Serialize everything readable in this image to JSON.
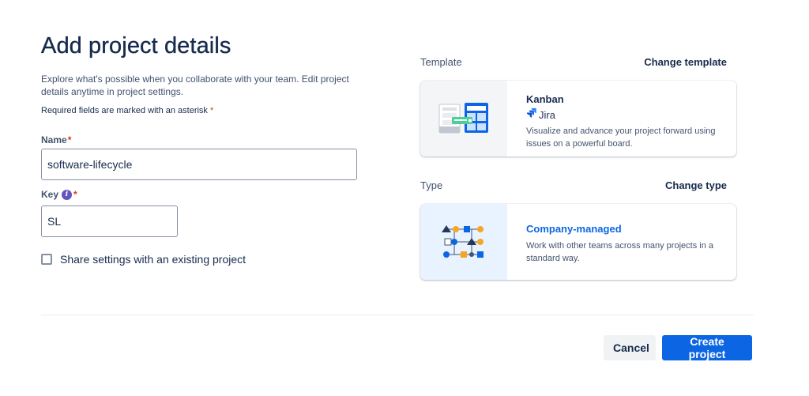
{
  "page": {
    "title": "Add project details",
    "intro": "Explore what's possible when you collaborate with your team. Edit project details anytime in project settings.",
    "required_note": "Required fields are marked with an asterisk",
    "asterisk": "*"
  },
  "form": {
    "name_label": "Name",
    "name_value": "software-lifecycle",
    "key_label": "Key",
    "key_value": "SL",
    "share_checkbox_label": "Share settings with an existing project",
    "share_checked": false
  },
  "template": {
    "section_label": "Template",
    "change_link": "Change template",
    "name": "Kanban",
    "product": "Jira",
    "description": "Visualize and advance your project forward using issues on a powerful board."
  },
  "type": {
    "section_label": "Type",
    "change_link": "Change type",
    "name": "Company-managed",
    "description": "Work with other teams across many projects in a standard way."
  },
  "actions": {
    "cancel_label": "Cancel",
    "create_label": "Create project"
  },
  "icons": {
    "info": "info-icon",
    "jira_logo": "jira-logo-icon",
    "kanban_illustration": "kanban-board-illustration",
    "company_managed_illustration": "company-managed-illustration"
  },
  "colors": {
    "primary": "#0c66e4",
    "text": "#172b4d",
    "required": "#de350b",
    "info": "#6554c0",
    "accent_yellow": "#f5a623",
    "accent_green": "#4bce97"
  }
}
